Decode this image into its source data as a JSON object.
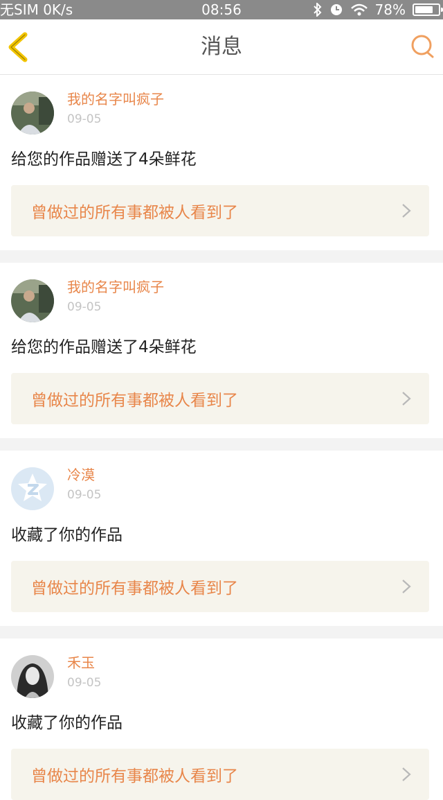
{
  "status_bar": {
    "carrier": "无SIM 0K/s",
    "time": "08:56",
    "battery": "78%",
    "battery_level": 0.78
  },
  "nav": {
    "title": "消息",
    "back_icon": "back-chevron-icon",
    "search_icon": "search-icon"
  },
  "colors": {
    "accent": "#e8864a",
    "nav_icon": "#f2c400",
    "quote_bg": "#f6f4ec"
  },
  "messages": [
    {
      "user": "我的名字叫疯子",
      "date": "09-05",
      "action": "给您的作品赠送了4朵鲜花",
      "work_title": "曾做过的所有事都被人看到了"
    },
    {
      "user": "我的名字叫疯子",
      "date": "09-05",
      "action": "给您的作品赠送了4朵鲜花",
      "work_title": "曾做过的所有事都被人看到了"
    },
    {
      "user": "冷漠",
      "date": "09-05",
      "action": "收藏了你的作品",
      "work_title": "曾做过的所有事都被人看到了"
    },
    {
      "user": "禾玉",
      "date": "09-05",
      "action": "收藏了你的作品",
      "work_title": "曾做过的所有事都被人看到了"
    }
  ]
}
